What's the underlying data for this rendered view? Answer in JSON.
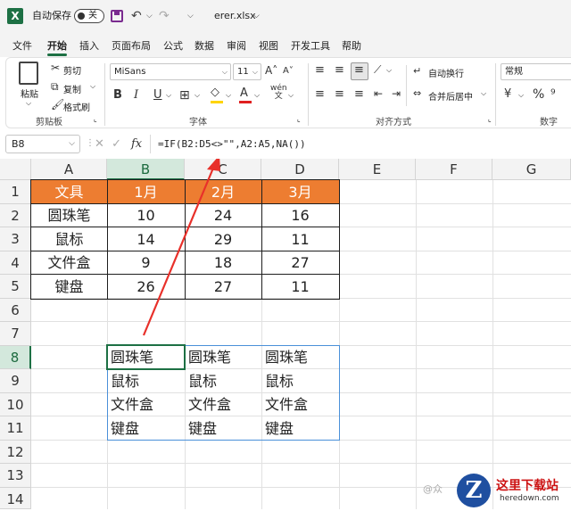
{
  "titlebar": {
    "app_icon": "excel-logo-icon",
    "autosave_label": "自动保存",
    "autosave_state": "关",
    "filename": "erer.xlsx",
    "filename_arrow": "⌵",
    "undo_glyph": "↶",
    "redo_glyph": "↷",
    "more_glyph": "⌵"
  },
  "menu": {
    "items": [
      "文件",
      "开始",
      "插入",
      "页面布局",
      "公式",
      "数据",
      "审阅",
      "视图",
      "开发工具",
      "帮助"
    ],
    "active": "开始"
  },
  "ribbon": {
    "clipboard": {
      "paste": "粘贴",
      "cut": "剪切",
      "copy": "复制",
      "format_painter": "格式刷",
      "label": "剪贴板"
    },
    "font": {
      "font_name": "MiSans",
      "font_size": "11",
      "bold": "B",
      "italic": "I",
      "underline": "U",
      "font_color_letter": "A",
      "label": "字体"
    },
    "alignment": {
      "wrap_text": "自动换行",
      "merge_center": "合并后居中",
      "label": "对齐方式"
    },
    "number": {
      "format": "常规",
      "currency": "¥",
      "percent": "%",
      "label": "数字"
    }
  },
  "formula_bar": {
    "name_box": "B8",
    "fx": "fx",
    "formula": "=IF(B2:D5<>\"\",A2:A5,NA())"
  },
  "grid": {
    "columns": [
      "A",
      "B",
      "C",
      "D",
      "E",
      "F",
      "G"
    ],
    "rows": [
      "1",
      "2",
      "3",
      "4",
      "5",
      "6",
      "7",
      "8",
      "9",
      "10",
      "11",
      "12",
      "13",
      "14"
    ],
    "selected_column": "B",
    "selected_row": "8",
    "table": {
      "header": [
        "文具",
        "1月",
        "2月",
        "3月"
      ],
      "rows": [
        [
          "圆珠笔",
          "10",
          "24",
          "16"
        ],
        [
          "鼠标",
          "14",
          "29",
          "11"
        ],
        [
          "文件盒",
          "9",
          "18",
          "27"
        ],
        [
          "键盘",
          "26",
          "27",
          "11"
        ]
      ],
      "header_color": "#ED7D31"
    },
    "spill": {
      "rows": [
        [
          "圆珠笔",
          "圆珠笔",
          "圆珠笔"
        ],
        [
          "鼠标",
          "鼠标",
          "鼠标"
        ],
        [
          "文件盒",
          "文件盒",
          "文件盒"
        ],
        [
          "键盘",
          "键盘",
          "键盘"
        ]
      ]
    }
  },
  "watermark": {
    "left": "@众",
    "logo_letter": "Z",
    "title": "这里下载站",
    "url": "heredown.com"
  },
  "colors": {
    "excel_green": "#1D7044",
    "arrow_red": "#E8302A",
    "spill_border": "#4A90D9"
  }
}
